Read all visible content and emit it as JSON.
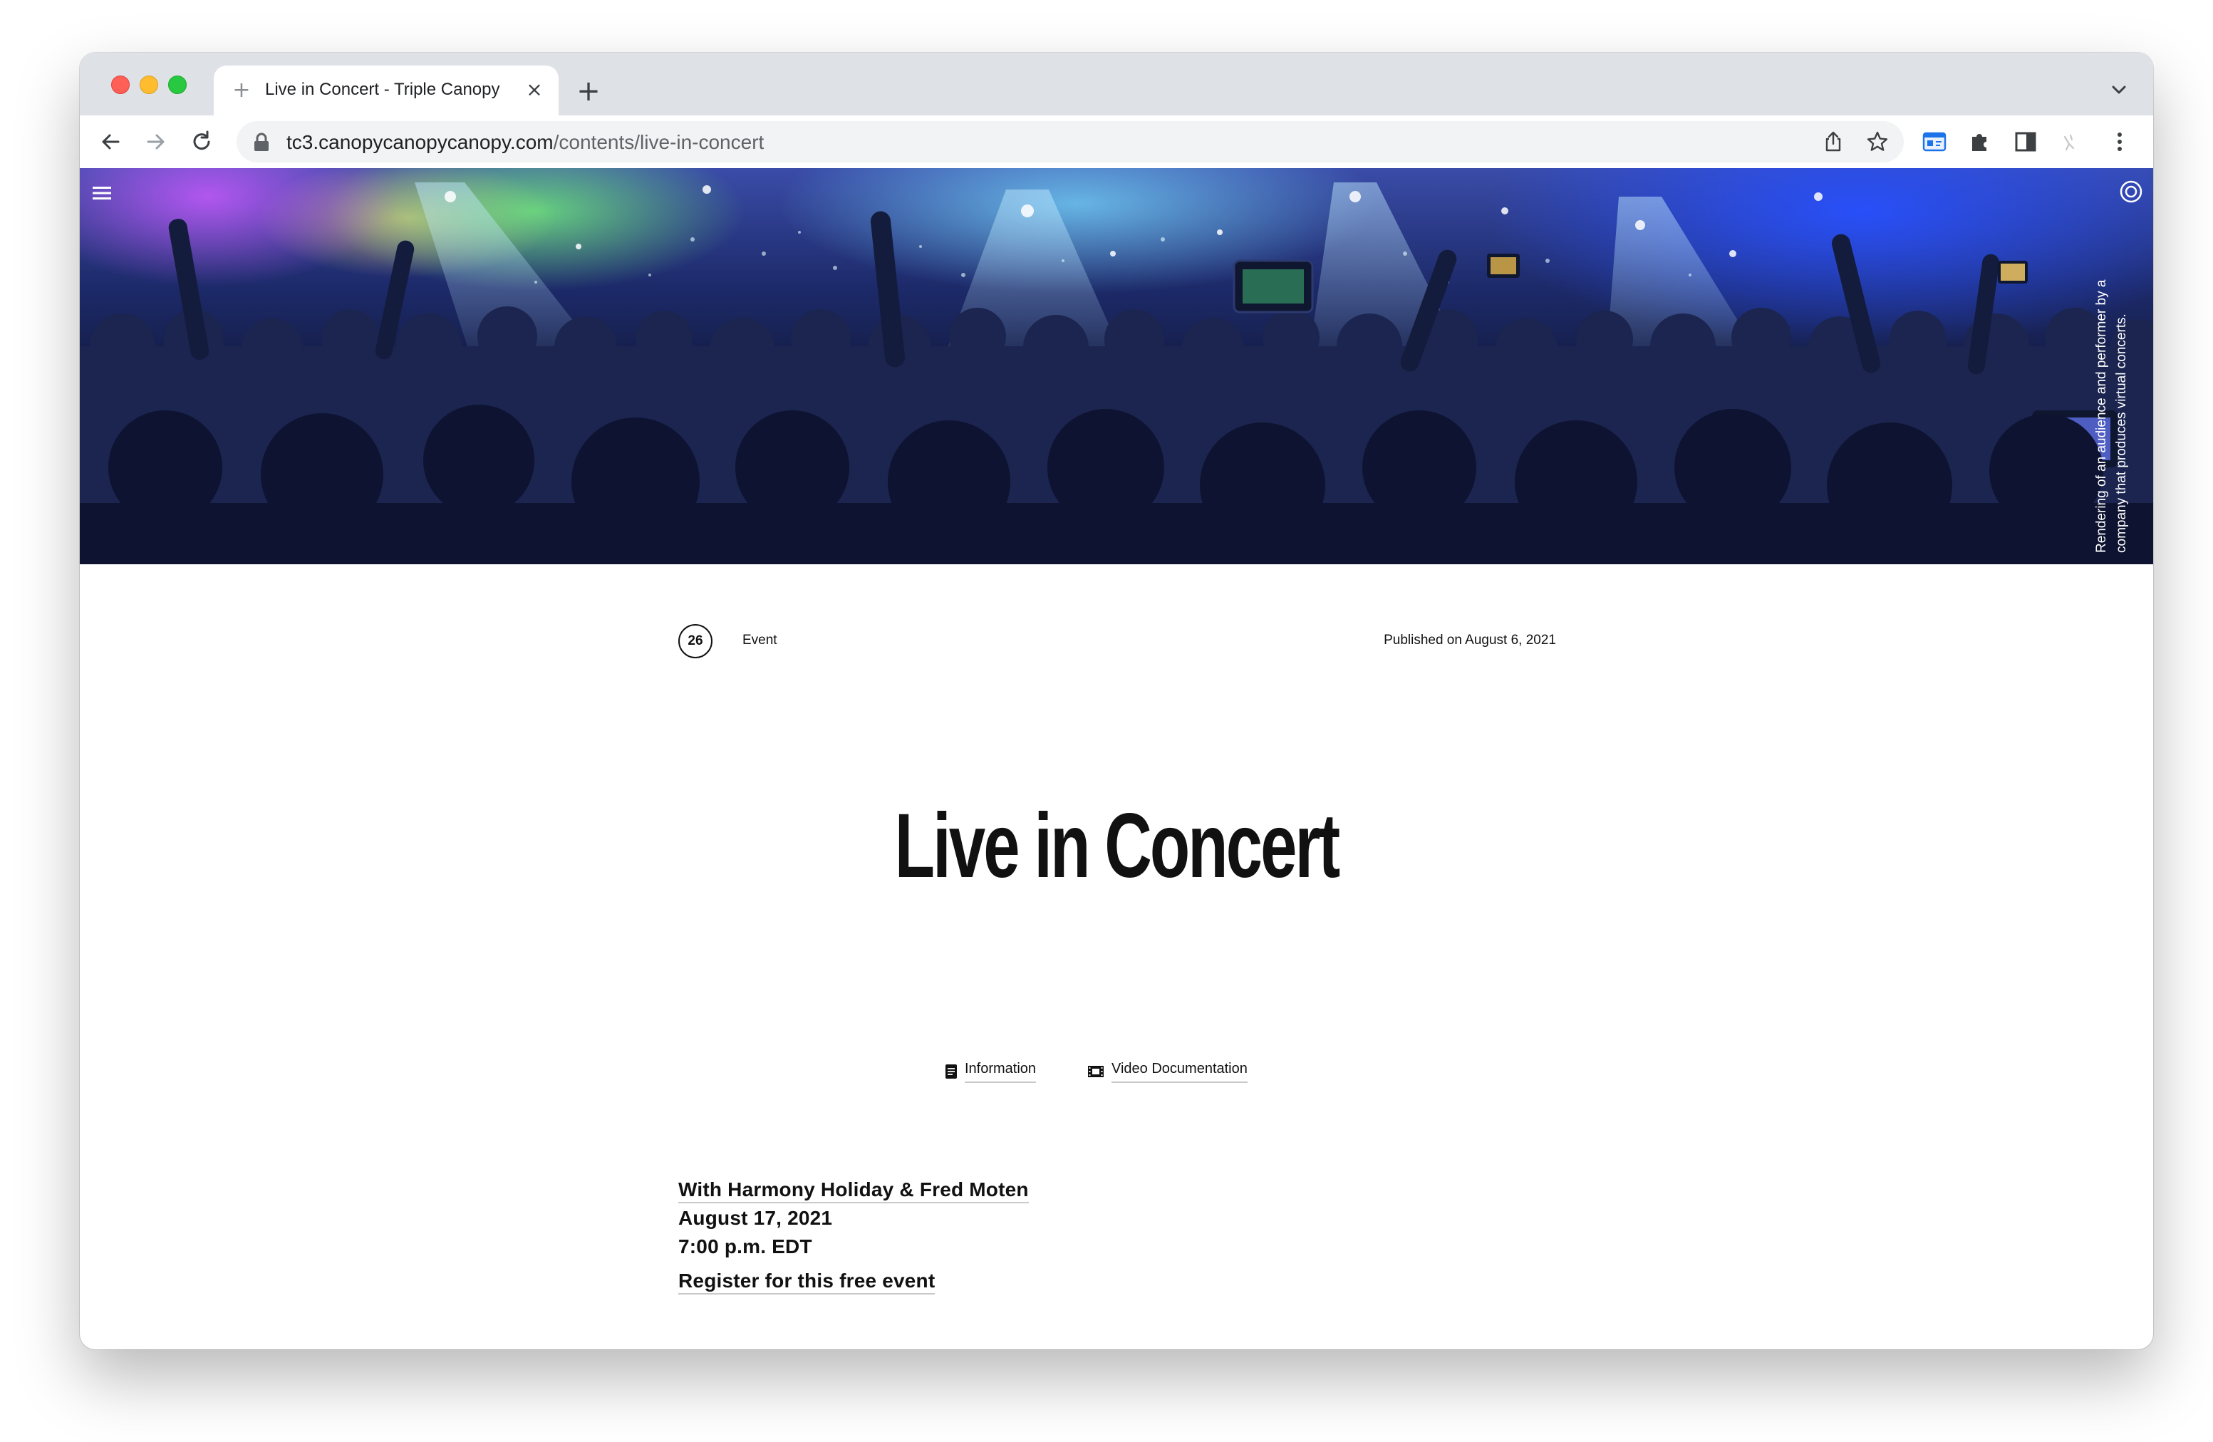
{
  "browser": {
    "tab": {
      "title": "Live in Concert - Triple Canopy"
    },
    "url": {
      "domain": "tc3.canopycanopycanopy.com",
      "path": "/contents/live-in-concert"
    }
  },
  "hero": {
    "caption": "Rendering of an audience and performer by a company that produces virtual concerts."
  },
  "meta": {
    "issue": "26",
    "type": "Event",
    "published": "Published on August 6, 2021"
  },
  "article": {
    "title": "Live in Concert",
    "sections": [
      {
        "label": "Information",
        "icon": "document-icon"
      },
      {
        "label": "Video Documentation",
        "icon": "film-icon"
      }
    ],
    "details": {
      "with": "With Harmony Holiday & Fred Moten",
      "date": "August 17, 2021",
      "time": "7:00 p.m. EDT",
      "register": "Register for this free event"
    }
  }
}
